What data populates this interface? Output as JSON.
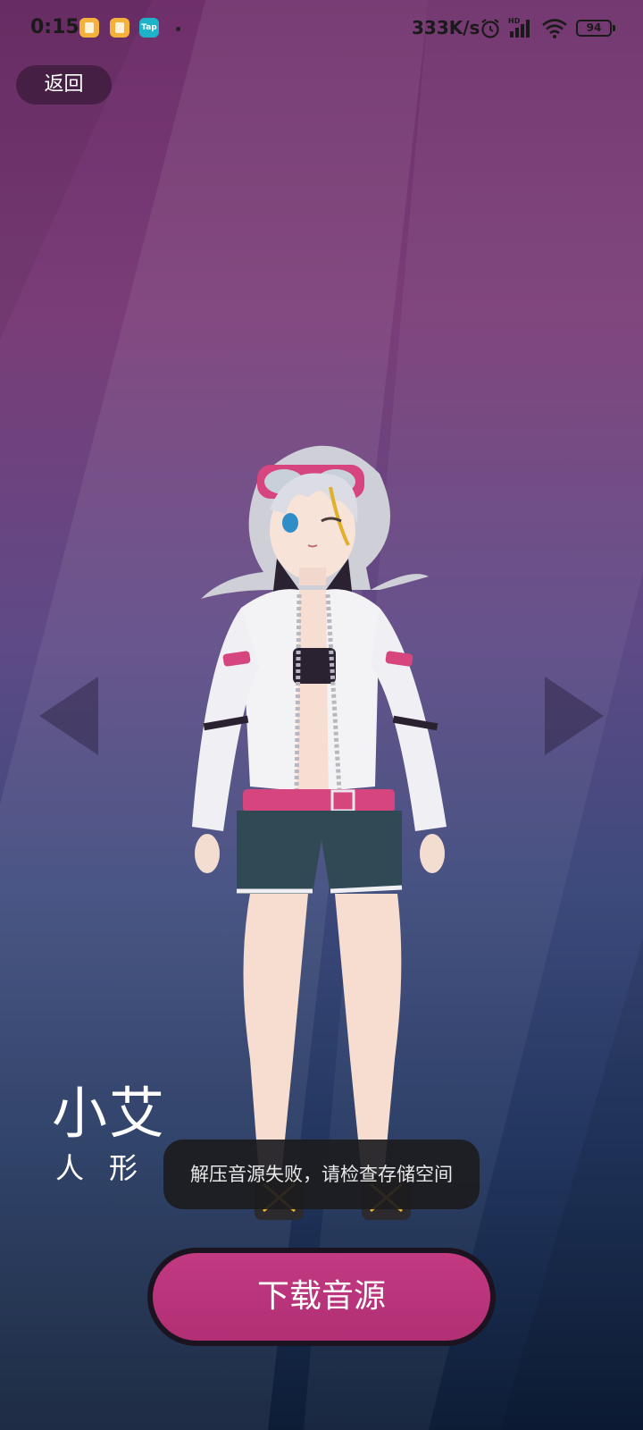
{
  "status_bar": {
    "time": "0:15",
    "tap_label": "Tap",
    "net_speed": "333K/s",
    "hd_label": "HD",
    "battery": "94",
    "icons": [
      "notification-app-icon",
      "notification-app-icon",
      "taptap-icon",
      "alarm-icon",
      "signal-icon",
      "wifi-icon",
      "battery-icon"
    ]
  },
  "header": {
    "back_label": "返回"
  },
  "character": {
    "name": "小艾",
    "type": "人形"
  },
  "toast": {
    "message": "解压音源失败，请检查存储空间"
  },
  "actions": {
    "download_label": "下载音源"
  },
  "colors": {
    "accent": "#c23a82",
    "toast_bg": "#1c1c20"
  }
}
